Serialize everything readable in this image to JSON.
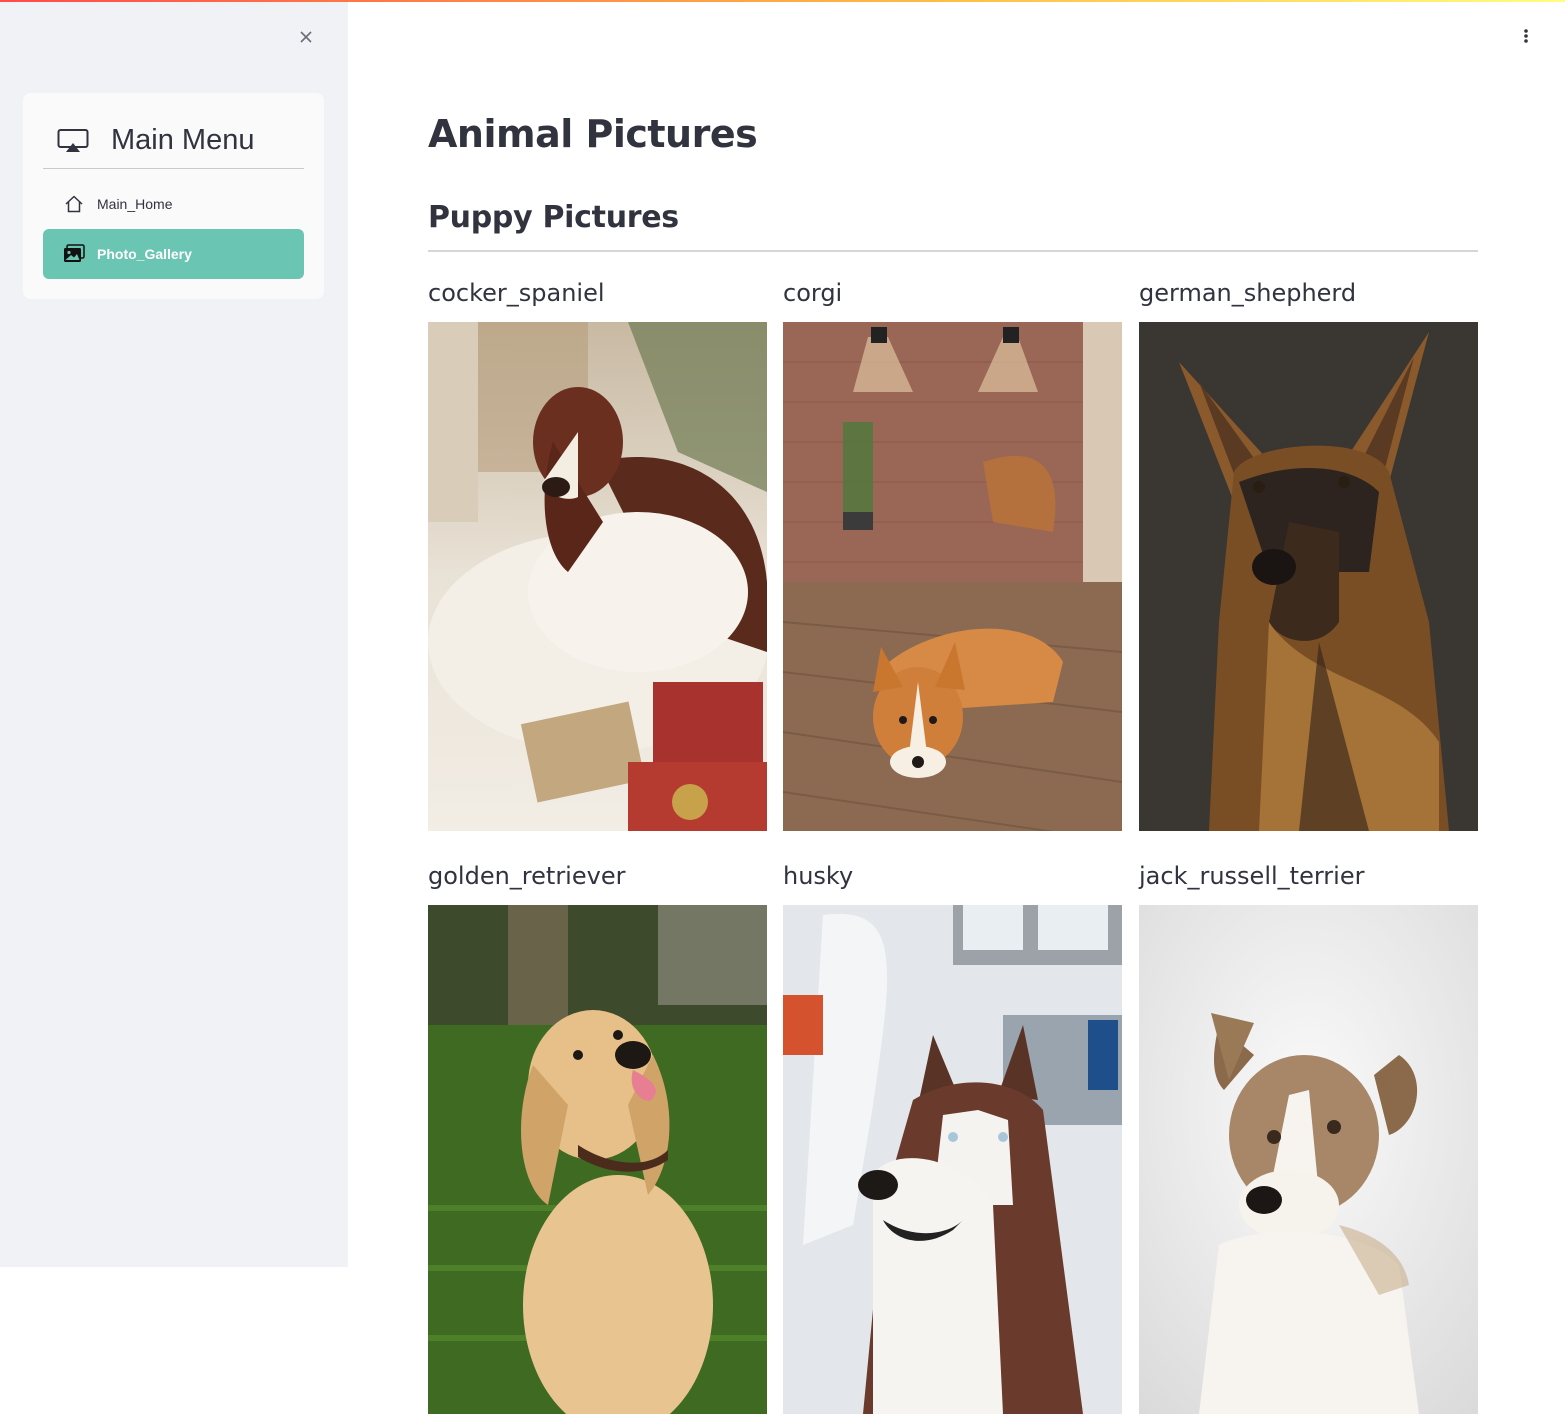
{
  "sidebar": {
    "close_icon": "close-icon",
    "menu": {
      "title": "Main Menu",
      "title_icon": "airplay-icon",
      "items": [
        {
          "label": "Main_Home",
          "icon": "house-icon",
          "active": false
        },
        {
          "label": "Photo_Gallery",
          "icon": "images-icon",
          "active": true
        }
      ],
      "active_color": "#6bc5b3"
    }
  },
  "header": {
    "menu_icon": "kebab-menu-icon"
  },
  "main": {
    "title": "Animal Pictures",
    "section": "Puppy Pictures",
    "gallery": [
      {
        "label": "cocker_spaniel"
      },
      {
        "label": "corgi"
      },
      {
        "label": "german_shepherd"
      },
      {
        "label": "golden_retriever"
      },
      {
        "label": "husky"
      },
      {
        "label": "jack_russell_terrier"
      }
    ]
  }
}
